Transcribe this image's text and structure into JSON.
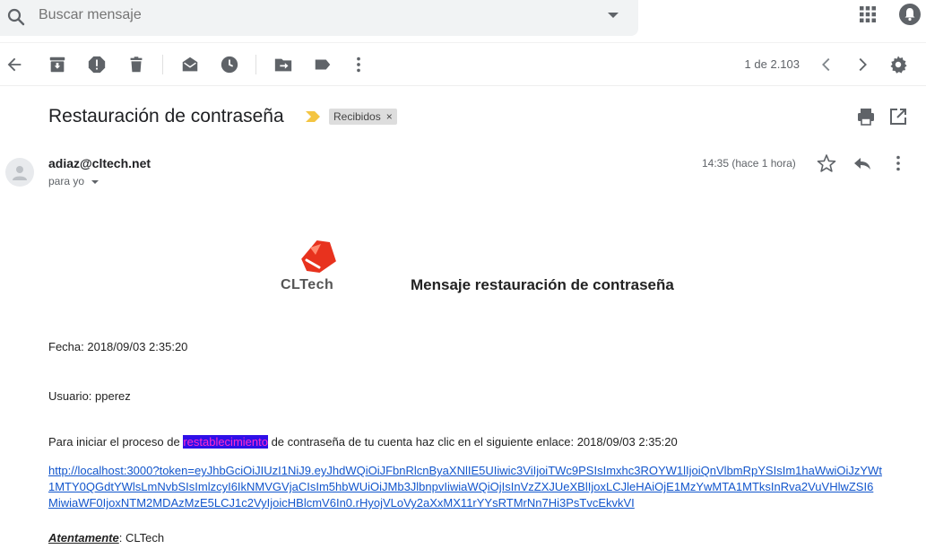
{
  "search": {
    "placeholder": "Buscar mensaje"
  },
  "toolbar": {
    "pager_text": "1 de 2.103"
  },
  "message": {
    "subject": "Restauración de contraseña",
    "label": "Recibidos",
    "label_close": "×",
    "sender": "adiaz@cltech.net",
    "to": "para yo",
    "time": "14:35 (hace 1 hora)"
  },
  "mail_body": {
    "logo_text": "CLTech",
    "title": "Mensaje restauración de contraseña",
    "fecha": "Fecha: 2018/09/03 2:35:20",
    "usuario": "Usuario: pperez",
    "intro_before": "Para iniciar el proceso de ",
    "intro_highlight": "restablecimiento",
    "intro_after": " de contraseña de tu cuenta haz clic en el siguiente enlace: 2018/09/03 2:35:20",
    "link": "http://localhost:3000?token=eyJhbGciOiJIUzI1NiJ9.eyJhdWQiOiJFbnRlcnByaXNlIE5UIiwic3ViIjoiTWc9PSIsImxhc3ROYW1lIjoiQnVlbmRpYSIsIm1haWwiOiJzYWt1MTY0QGdtYWlsLmNvbSIsImlzcyI6IkNMVGVjaCIsIm5hbWUiOiJMb3JlbnpvIiwiaWQiOjIsInVzZXJUeXBlIjoxLCJleHAiOjE1MzYwMTA1MTksInRva2VuVHlwZSI6MiwiaWF0IjoxNTM2MDAzMzE5LCJ1c2VyIjoicHBlcmV6In0.rHyojVLoVy2aXxMX11rYYsRTMrNn7Hi3PsTvcEkvkVI",
    "sign_label": "Atentamente",
    "sign_sep": ": ",
    "sign_name": "CLTech"
  },
  "colors": {
    "highlight_bg": "#2f0fe8",
    "highlight_fg": "#ff2ccb",
    "link": "#1155cc",
    "logo_red": "#e8321e",
    "importance": "#f4c542"
  }
}
